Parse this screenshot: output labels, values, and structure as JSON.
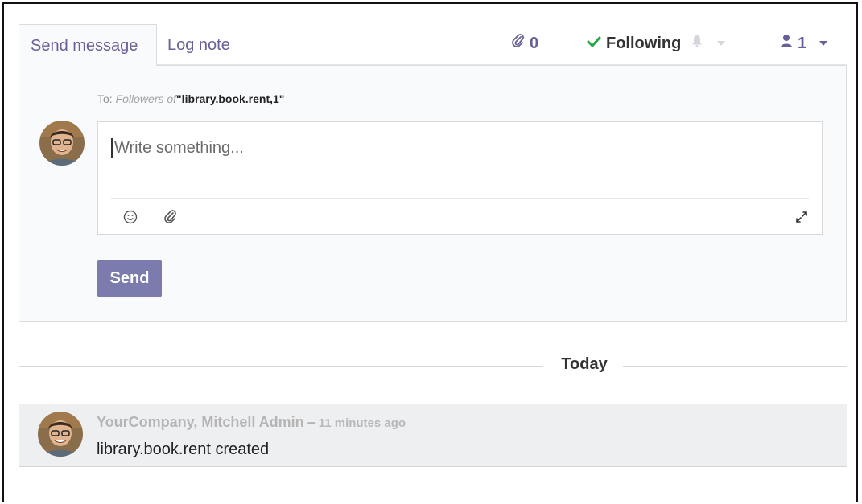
{
  "tabs": {
    "send_message": "Send message",
    "log_note": "Log note"
  },
  "topbar": {
    "attachments_count": "0",
    "following_label": "Following",
    "followers_count": "1"
  },
  "composer": {
    "to_prefix": "To:",
    "followers_of": "Followers of",
    "target": "\"library.book.rent,1\"",
    "placeholder": "Write something...",
    "send_label": "Send"
  },
  "separator": {
    "label": "Today"
  },
  "message": {
    "author": "YourCompany, Mitchell Admin",
    "dash": "–",
    "time": "11 minutes ago",
    "body": "library.book.rent created"
  },
  "icons": {
    "paperclip": "paperclip-icon",
    "check": "check-icon",
    "bell": "bell-icon",
    "user": "user-icon",
    "emoji": "smiley-icon",
    "expand": "expand-icon"
  },
  "colors": {
    "accent": "#6a5f96",
    "send_button": "#7c7bad",
    "check": "#28a745",
    "panel_bg": "#f9fafc",
    "message_bg": "#eeeff1"
  }
}
